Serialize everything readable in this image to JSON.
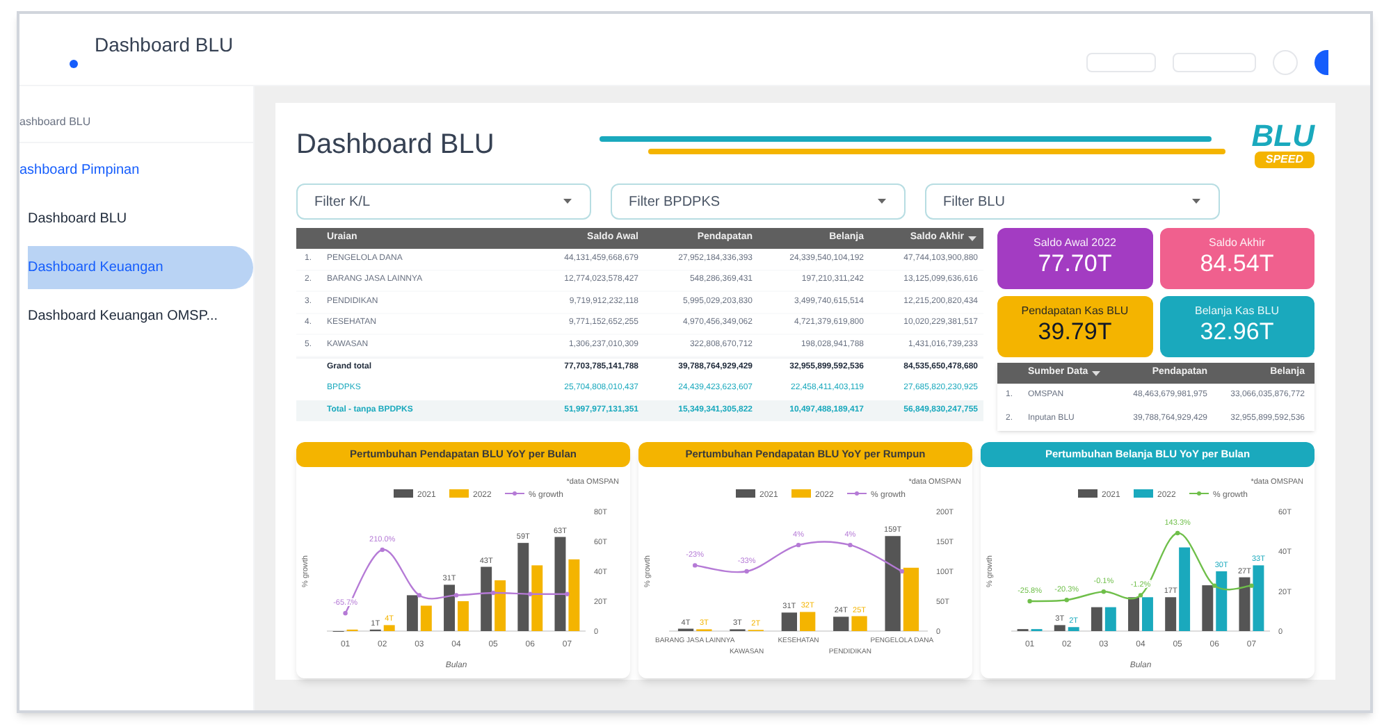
{
  "app_bar": {
    "title": "Dashboard BLU"
  },
  "sidebar": {
    "heading": "ashboard BLU",
    "items": [
      {
        "label": "ashboard Pimpinan",
        "kind": "link",
        "selected": false
      },
      {
        "label": "Dashboard BLU",
        "kind": "item",
        "selected": false
      },
      {
        "label": "Dashboard Keuangan",
        "kind": "item",
        "selected": true
      },
      {
        "label": "Dashboard Keuangan OMSP...",
        "kind": "item",
        "selected": false
      }
    ]
  },
  "page": {
    "title": "Dashboard BLU",
    "logo": {
      "top": "BLU",
      "bottom": "SPEED"
    }
  },
  "filters": [
    {
      "placeholder": "Filter K/L"
    },
    {
      "placeholder": "Filter BPDPKS"
    },
    {
      "placeholder": "Filter BLU"
    }
  ],
  "table": {
    "columns": [
      {
        "label": "Uraian",
        "sorted": false
      },
      {
        "label": "Saldo Awal",
        "sorted": false
      },
      {
        "label": "Pendapatan",
        "sorted": false
      },
      {
        "label": "Belanja",
        "sorted": false
      },
      {
        "label": "Saldo Akhir",
        "sorted": true
      }
    ],
    "rows": [
      {
        "kind": "item",
        "no": "1.",
        "cells": [
          "PENGELOLA DANA",
          "44,131,459,668,679",
          "27,952,184,336,393",
          "24,339,540,104,192",
          "47,744,103,900,880"
        ]
      },
      {
        "kind": "item",
        "no": "2.",
        "cells": [
          "BARANG JASA LAINNYA",
          "12,774,023,578,427",
          "548,286,369,431",
          "197,210,311,242",
          "13,125,099,636,616"
        ]
      },
      {
        "kind": "item",
        "no": "3.",
        "cells": [
          "PENDIDIKAN",
          "9,719,912,232,118",
          "5,995,029,203,830",
          "3,499,740,615,514",
          "12,215,200,820,434"
        ]
      },
      {
        "kind": "item",
        "no": "4.",
        "cells": [
          "KESEHATAN",
          "9,771,152,652,255",
          "4,970,456,349,062",
          "4,721,379,619,800",
          "10,020,229,381,517"
        ]
      },
      {
        "kind": "item",
        "no": "5.",
        "cells": [
          "KAWASAN",
          "1,306,237,010,309",
          "322,808,670,712",
          "198,028,941,788",
          "1,431,016,739,233"
        ]
      },
      {
        "kind": "total",
        "cells": [
          "Grand total",
          "77,703,785,141,788",
          "39,788,764,929,429",
          "32,955,899,592,536",
          "84,535,650,478,680"
        ]
      },
      {
        "kind": "bpdpks",
        "cells": [
          "BPDPKS",
          "25,704,808,010,437",
          "24,439,423,623,607",
          "22,458,411,403,119",
          "27,685,820,230,925"
        ]
      },
      {
        "kind": "net",
        "cells": [
          "Total - tanpa BPDPKS",
          "51,997,977,131,351",
          "15,349,341,305,822",
          "10,497,488,189,417",
          "56,849,830,247,755"
        ]
      }
    ]
  },
  "kpis": [
    {
      "label": "Saldo Awal 2022",
      "value": "77.70T",
      "color": "#a33cc2"
    },
    {
      "label": "Saldo Akhir",
      "value": "84.54T",
      "color": "#f0608e"
    },
    {
      "label": "Pendapatan Kas BLU",
      "value": "39.79T",
      "color": "#f4b400"
    },
    {
      "label": "Belanja Kas BLU",
      "value": "32.96T",
      "color": "#1aa9bd"
    }
  ],
  "source_table": {
    "columns": [
      {
        "label": "Sumber Data",
        "sorted": true
      },
      {
        "label": "Pendapatan",
        "sorted": false
      },
      {
        "label": "Belanja",
        "sorted": false
      }
    ],
    "rows": [
      {
        "no": "1.",
        "cells": [
          "OMSPAN",
          "48,463,679,981,975",
          "33,066,035,876,772"
        ]
      },
      {
        "no": "2.",
        "cells": [
          "Inputan BLU",
          "39,788,764,929,429",
          "32,955,899,592,536"
        ]
      }
    ]
  },
  "charts": [
    {
      "title": "Pertumbuhan Pendapatan BLU YoY per Bulan",
      "color": "#f4b400",
      "note": "*data OMSPAN",
      "growth_line": {
        "name": "% growth",
        "color": "#b57ad6",
        "labels": [
          "-65.7%",
          "210.0%"
        ]
      },
      "chart_data": {
        "type": "bar",
        "xlabel": "Bulan",
        "ylabel": "% growth",
        "legend": "top",
        "categories": [
          "01",
          "02",
          "03",
          "04",
          "05",
          "06",
          "07"
        ],
        "ylim": [
          0,
          80
        ],
        "yticks": [
          {
            "value": 0,
            "label": "0"
          },
          {
            "value": 20,
            "label": "20T"
          },
          {
            "value": 40,
            "label": "40T"
          },
          {
            "value": 60,
            "label": "60T"
          },
          {
            "value": 80,
            "label": "80T"
          }
        ],
        "series": [
          {
            "name": "2021",
            "color": "#555555",
            "values": [
              0,
              1,
              24,
              31,
              43,
              59,
              63
            ],
            "value_labels": [
              null,
              "1T",
              null,
              "31T",
              "43T",
              "59T",
              "63T"
            ]
          },
          {
            "name": "2022",
            "color": "#f4b400",
            "values": [
              1,
              4,
              17,
              20,
              34,
              44,
              48
            ],
            "value_labels": [
              null,
              "4T",
              null,
              null,
              null,
              null,
              null
            ]
          }
        ]
      }
    },
    {
      "title": "Pertumbuhan Pendapatan BLU YoY per Rumpun",
      "color": "#f4b400",
      "note": "*data OMSPAN",
      "growth_line": {
        "name": "% growth",
        "color": "#b57ad6",
        "labels": [
          "-23%",
          "-33%",
          "4%",
          "4%"
        ]
      },
      "chart_data": {
        "type": "bar",
        "ylabel": "% growth",
        "legend": "top",
        "categories": [
          "BARANG JASA LAINNYA",
          "KAWASAN",
          "KESEHATAN",
          "PENDIDIKAN",
          "PENGELOLA DANA"
        ],
        "ylim": [
          0,
          200
        ],
        "yticks": [
          {
            "value": 0,
            "label": "0"
          },
          {
            "value": 50,
            "label": "50T"
          },
          {
            "value": 100,
            "label": "100T"
          },
          {
            "value": 150,
            "label": "150T"
          },
          {
            "value": 200,
            "label": "200T"
          }
        ],
        "series": [
          {
            "name": "2021",
            "color": "#555555",
            "values": [
              4,
              3,
              31,
              24,
              159
            ],
            "value_labels": [
              "4T",
              "3T",
              "31T",
              "24T",
              "159T"
            ]
          },
          {
            "name": "2022",
            "color": "#f4b400",
            "values": [
              3,
              2,
              32,
              25,
              106
            ],
            "value_labels": [
              "3T",
              "2T",
              "32T",
              "25T",
              null
            ]
          }
        ]
      }
    },
    {
      "title": "Pertumbuhan Belanja BLU YoY per Bulan",
      "color": "#1aa9bd",
      "note": "*data OMSPAN",
      "growth_line": {
        "name": "% growth",
        "color": "#6fbf4a",
        "labels": [
          "-25.8%",
          "-20.3%",
          "-0.1%",
          "-1.2%",
          "143.3%"
        ]
      },
      "chart_data": {
        "type": "bar",
        "xlabel": "Bulan",
        "ylabel": "% growth",
        "legend": "top",
        "categories": [
          "01",
          "02",
          "03",
          "04",
          "05",
          "06",
          "07"
        ],
        "ylim": [
          0,
          60
        ],
        "yticks": [
          {
            "value": 0,
            "label": "0"
          },
          {
            "value": 20,
            "label": "20T"
          },
          {
            "value": 40,
            "label": "40T"
          },
          {
            "value": 60,
            "label": "60T"
          }
        ],
        "series": [
          {
            "name": "2021",
            "color": "#555555",
            "values": [
              1,
              3,
              12,
              17,
              17,
              23,
              27
            ],
            "value_labels": [
              null,
              "3T",
              null,
              null,
              "17T",
              null,
              "27T"
            ]
          },
          {
            "name": "2022",
            "color": "#1aa9bd",
            "values": [
              1,
              2,
              12,
              17,
              42,
              30,
              33
            ],
            "value_labels": [
              null,
              "2T",
              null,
              null,
              null,
              "30T",
              "33T"
            ]
          }
        ]
      }
    }
  ]
}
